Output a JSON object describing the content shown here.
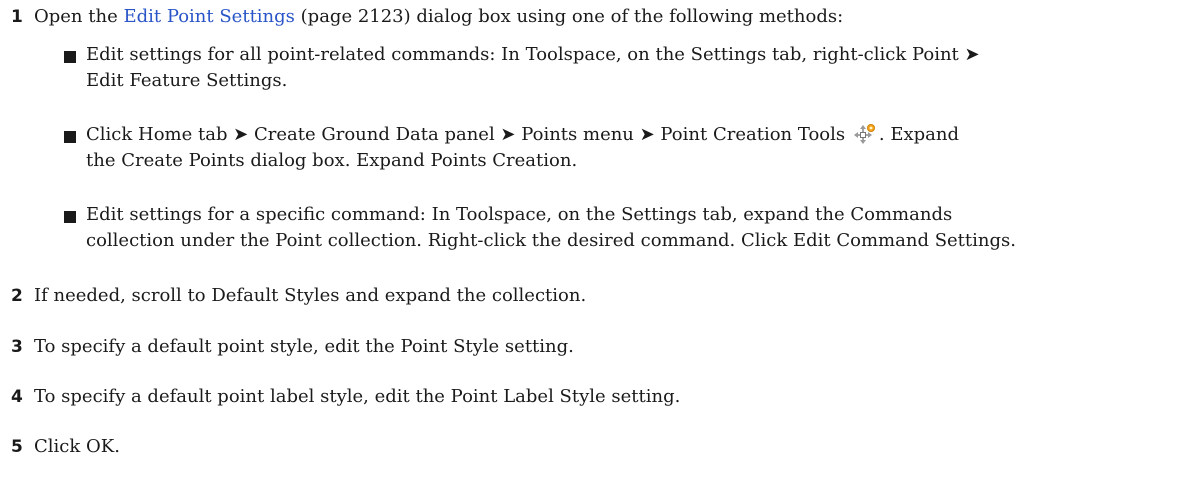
{
  "steps": [
    {
      "num": "1",
      "pre": "Open the ",
      "link": "Edit Point Settings",
      "post": " (page 2123) dialog box using one of the following methods:",
      "bullets": [
        {
          "line1": "Edit settings for all point-related commands: In Toolspace, on the Settings tab, right-click Point ➤",
          "line2": "Edit Feature Settings."
        },
        {
          "line1_pre": "Click Home tab ➤ Create Ground Data panel ➤ Points menu ➤ Point Creation Tools",
          "icon": "point-creation-tools-icon",
          "line1_post": ". Expand",
          "line2": "the Create Points dialog box. Expand Points Creation."
        },
        {
          "line1": "Edit settings for a specific command: In Toolspace, on the Settings tab, expand the Commands",
          "line2": "collection under the Point collection. Right-click the desired command. Click Edit Command Settings."
        }
      ]
    },
    {
      "num": "2",
      "text": "If needed, scroll to Default Styles and expand the collection."
    },
    {
      "num": "3",
      "text": "To specify a default point style, edit the Point Style setting."
    },
    {
      "num": "4",
      "text": "To specify a default point label style, edit the Point Label Style setting."
    },
    {
      "num": "5",
      "text": "Click OK."
    }
  ],
  "colors": {
    "link": "#2a55c8",
    "text": "#1a1a1a"
  }
}
